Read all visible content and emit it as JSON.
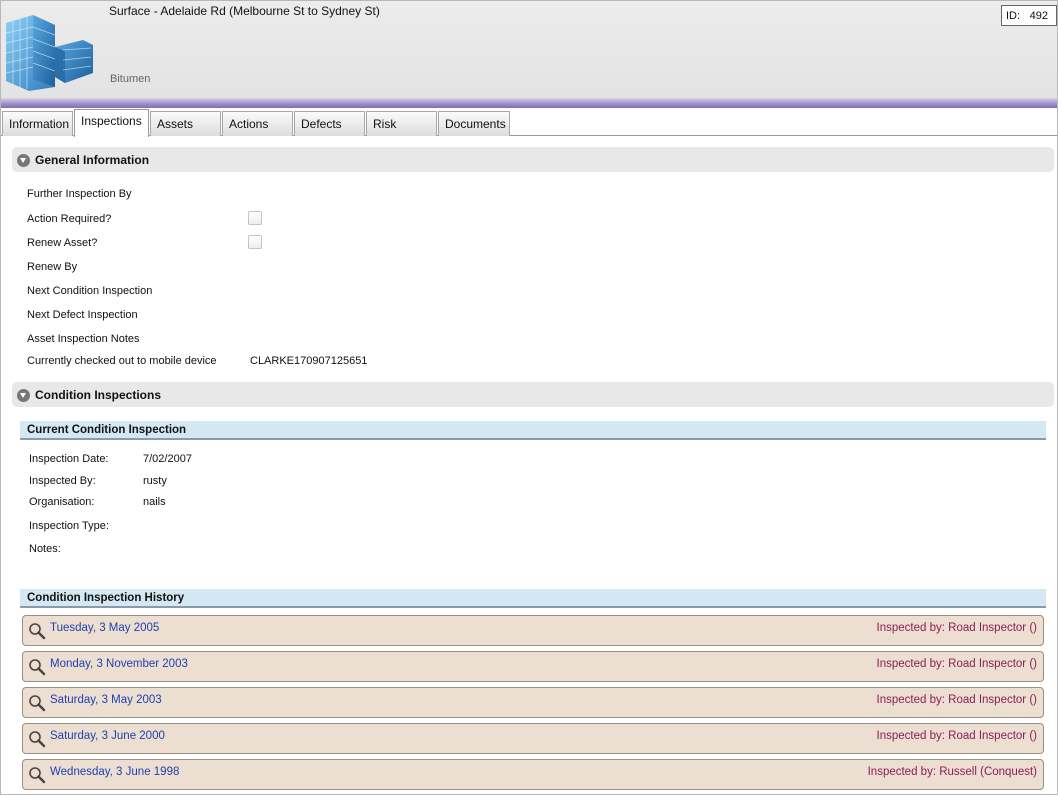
{
  "header": {
    "title": "Surface - Adelaide Rd (Melbourne St to Sydney St)",
    "subtitle": "Bitumen",
    "id_label": "ID:",
    "id_value": "492"
  },
  "tabs": [
    "Information",
    "Inspections",
    "Assets",
    "Actions",
    "Defects",
    "Risk",
    "Documents"
  ],
  "active_tab": "Inspections",
  "general_information": {
    "title": "General Information",
    "fields": {
      "further_inspection_by": "Further Inspection By",
      "action_required": "Action Required?",
      "renew_asset": "Renew Asset?",
      "renew_by": "Renew By",
      "next_condition_inspection": "Next Condition Inspection",
      "next_defect_inspection": "Next Defect Inspection",
      "asset_inspection_notes": "Asset Inspection Notes",
      "checked_out_label": "Currently checked out to mobile device",
      "checked_out_value": "CLARKE170907125651"
    },
    "action_required_checked": false,
    "renew_asset_checked": false
  },
  "condition_inspections": {
    "title": "Condition Inspections",
    "current": {
      "title": "Current Condition Inspection",
      "inspection_date_label": "Inspection Date:",
      "inspection_date": "7/02/2007",
      "inspected_by_label": "Inspected By:",
      "inspected_by": "rusty",
      "organisation_label": "Organisation:",
      "organisation": "nails",
      "inspection_type_label": "Inspection Type:",
      "notes_label": "Notes:"
    },
    "history": {
      "title": "Condition Inspection History",
      "rows": [
        {
          "date": "Tuesday, 3 May 2005",
          "inspected_by": "Inspected by: Road Inspector ()"
        },
        {
          "date": "Monday, 3 November 2003",
          "inspected_by": "Inspected by: Road Inspector ()"
        },
        {
          "date": "Saturday, 3 May 2003",
          "inspected_by": "Inspected by: Road Inspector ()"
        },
        {
          "date": "Saturday, 3 June 2000",
          "inspected_by": "Inspected by: Road Inspector ()"
        },
        {
          "date": "Wednesday, 3 June 1998",
          "inspected_by": "Inspected by: Russell (Conquest)"
        }
      ]
    }
  },
  "colors": {
    "header_band": "#8070b4",
    "section_bg": "#e8e8e8",
    "subsection_bg": "#d4e8f4",
    "history_row_bg": "#ecdfd2",
    "history_date": "#1f3fae",
    "history_inspector": "#8b1e55"
  },
  "icons": {
    "logo": "building-icon",
    "collapse": "collapse-icon",
    "history_row": "magnifier-icon"
  }
}
